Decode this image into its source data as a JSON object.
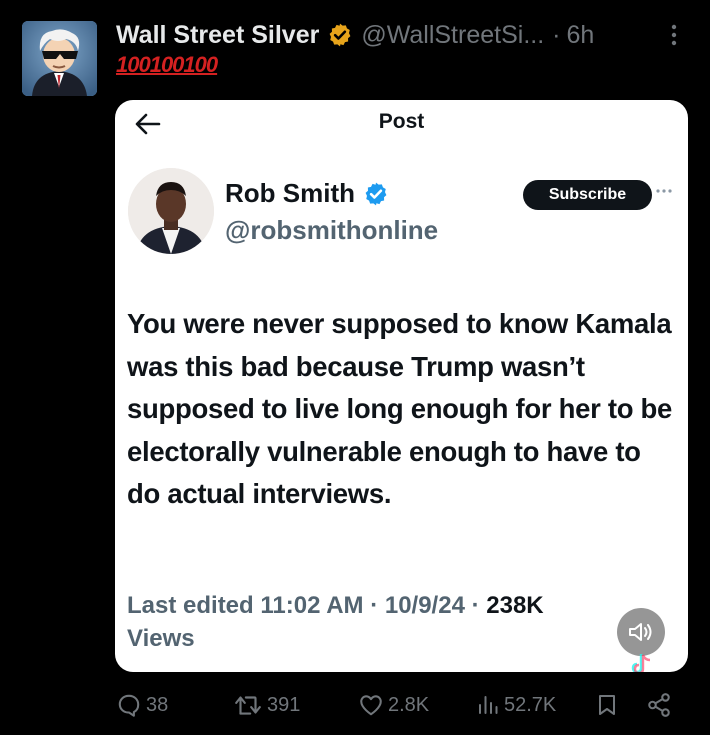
{
  "tweet": {
    "display_name": "Wall Street Silver",
    "handle": "@WallStreetSi...",
    "separator": "·",
    "time": "6h",
    "emoji_line": "100100100",
    "colors": {
      "verified": "#e7a41b",
      "emoji": "#d42121"
    }
  },
  "embedded_post": {
    "title": "Post",
    "author_name": "Rob Smith",
    "author_handle": "@robsmithonline",
    "subscribe_label": "Subscribe",
    "text": "You were never supposed to know Kamala was this bad because Trump wasn’t supposed to live long enough for her to be electorally vulnerable enough to have to do actual interviews.",
    "meta_prefix": "Last edited 11:02 AM · 10/9/24 · ",
    "views_count": "238K",
    "views_label": "Views",
    "colors": {
      "verified": "#1d9bf0"
    }
  },
  "actions": {
    "replies": "38",
    "reposts": "391",
    "likes": "2.8K",
    "views": "52.7K"
  }
}
